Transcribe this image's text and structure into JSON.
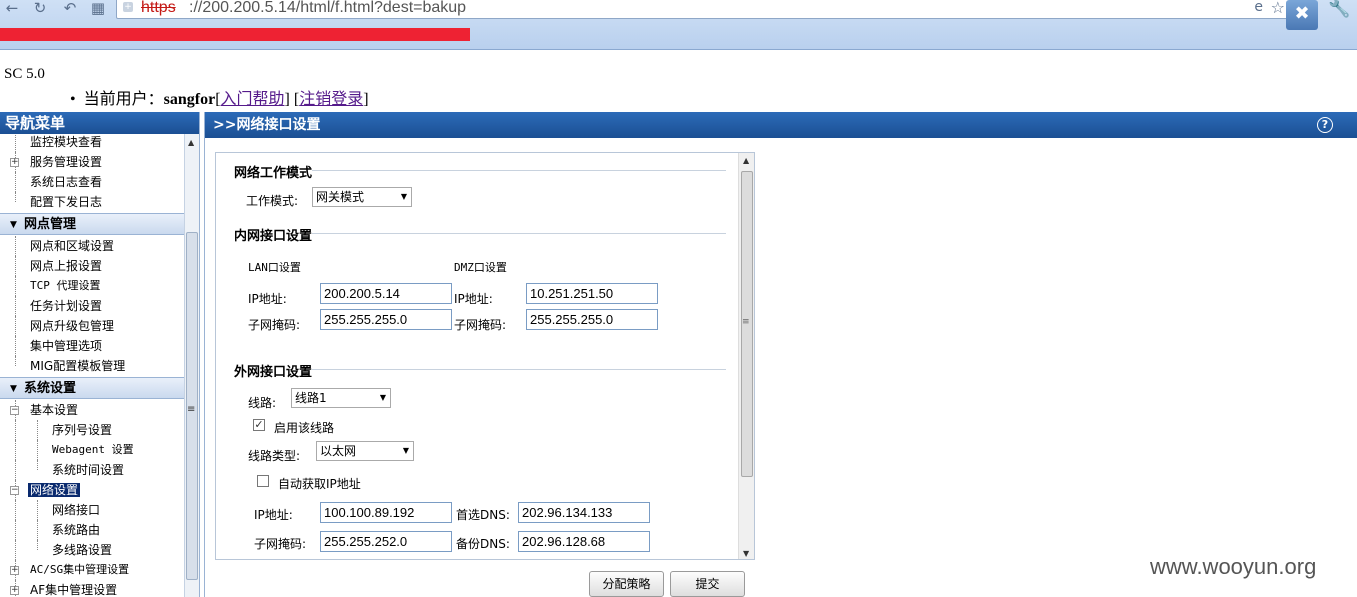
{
  "browser": {
    "url_scheme": "https",
    "url_rest": "://200.200.5.14/html/f.html?dest=bakup"
  },
  "header": {
    "version": "SC 5.0",
    "user_prefix": "当前用户：",
    "username": "sangfor",
    "help_link": "入门帮助",
    "logout_link": "注销登录"
  },
  "nav": {
    "title": "导航菜单",
    "top_items": [
      {
        "label": "监控模块查看"
      },
      {
        "label": "服务管理设置"
      },
      {
        "label": "系统日志查看"
      },
      {
        "label": "配置下发日志"
      }
    ],
    "section1": "网点管理",
    "section1_items": [
      {
        "label": "网点和区域设置"
      },
      {
        "label": "网点上报设置"
      },
      {
        "label": "TCP 代理设置"
      },
      {
        "label": "任务计划设置"
      },
      {
        "label": "网点升级包管理"
      },
      {
        "label": "集中管理选项"
      },
      {
        "label": "MIG配置模板管理"
      }
    ],
    "section2": "系统设置",
    "basic": "基本设置",
    "basic_items": [
      {
        "label": "序列号设置"
      },
      {
        "label": "Webagent 设置"
      },
      {
        "label": "系统时间设置"
      }
    ],
    "network": "网络设置",
    "network_items": [
      {
        "label": "网络接口"
      },
      {
        "label": "系统路由"
      },
      {
        "label": "多线路设置"
      }
    ],
    "acsg": "AC/SG集中管理设置",
    "af": "AF集中管理设置"
  },
  "panel": {
    "title": ">>网络接口设置",
    "work_mode_section": "网络工作模式",
    "work_mode_label": "工作模式:",
    "work_mode_value": "网关模式",
    "lan_section": "内网接口设置",
    "lan_title": "LAN口设置",
    "dmz_title": "DMZ口设置",
    "ip_label": "IP地址:",
    "mask_label": "子网掩码:",
    "lan_ip": "200.200.5.14",
    "lan_mask": "255.255.255.0",
    "dmz_ip": "10.251.251.50",
    "dmz_mask": "255.255.255.0",
    "wan_section": "外网接口设置",
    "line_label": "线路:",
    "line_value": "线路1",
    "enable_line": "启用该线路",
    "line_type_label": "线路类型:",
    "line_type_value": "以太网",
    "auto_ip": "自动获取IP地址",
    "wan_ip": "100.100.89.192",
    "wan_mask": "255.255.252.0",
    "dns1_label": "首选DNS:",
    "dns1": "202.96.134.133",
    "dns2_label": "备份DNS:",
    "dns2": "202.96.128.68",
    "btn_policy": "分配策略",
    "btn_submit": "提交"
  },
  "watermark": "www.wooyun.org"
}
